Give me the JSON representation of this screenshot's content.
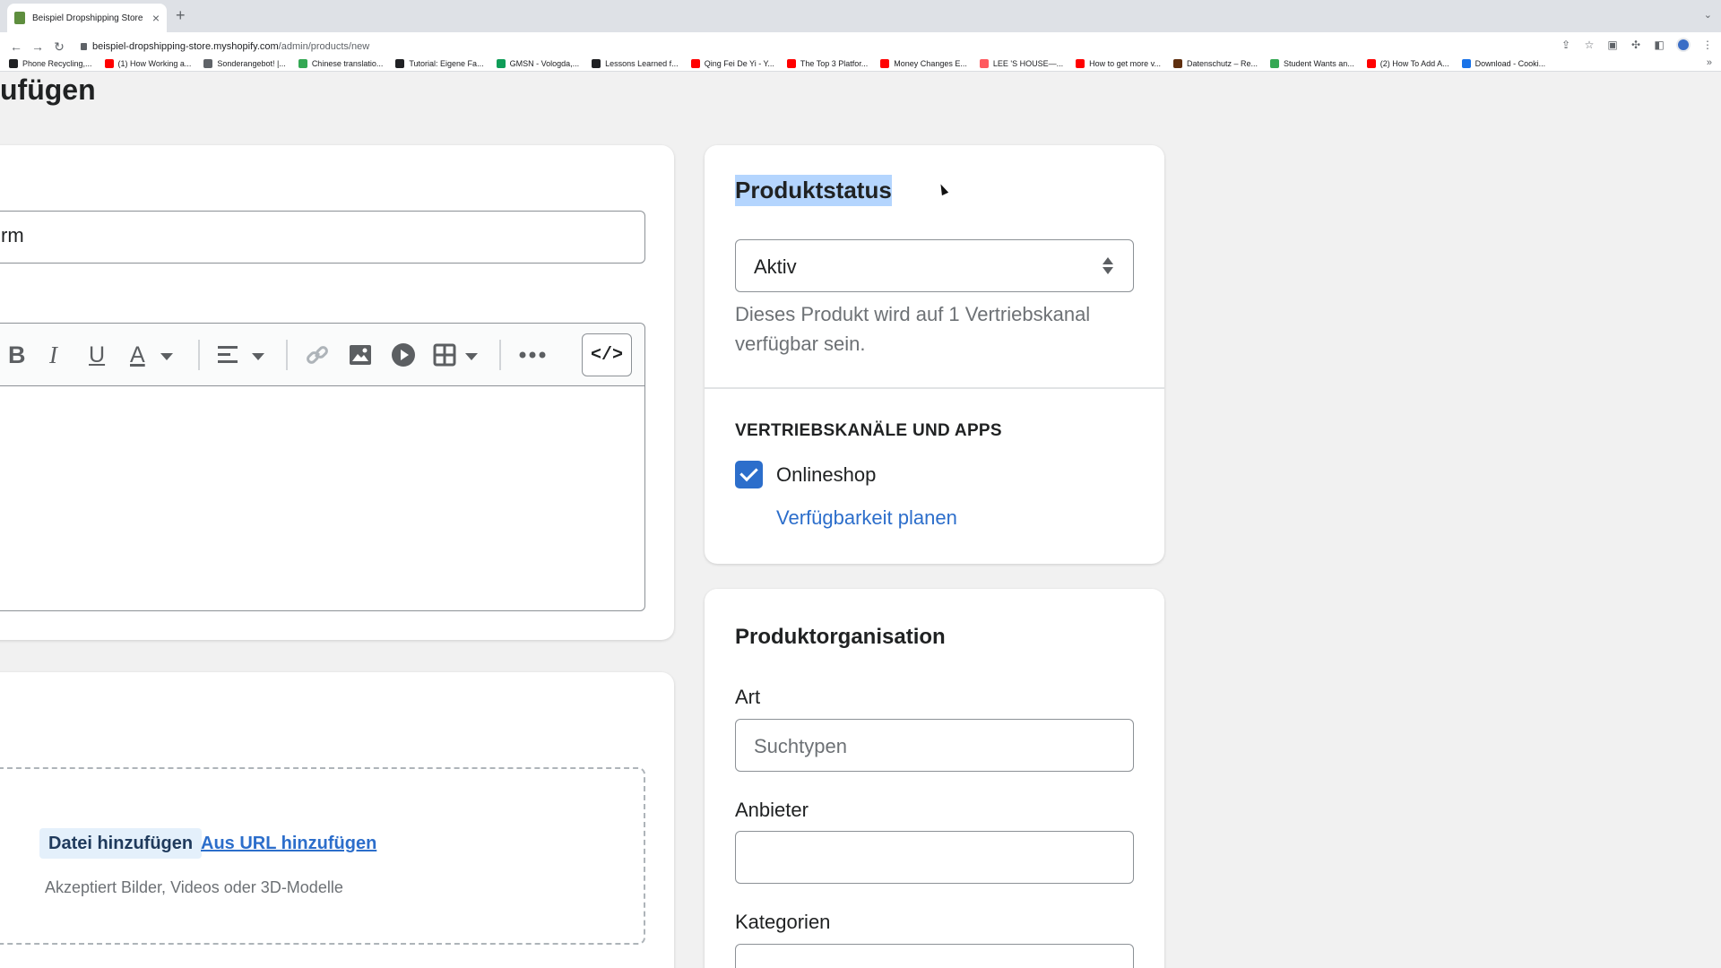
{
  "browser": {
    "tab_title": "Beispiel Dropshipping Store · Produkt hinzufügen",
    "new_tab": "+",
    "close": "×",
    "url_host": "beispiel-dropshipping-store.myshopify.com",
    "url_path": "/admin/products/new",
    "bookmarks": [
      {
        "label": "Phone Recycling,...",
        "color": "#202124"
      },
      {
        "label": "(1) How Working a...",
        "color": "#ff0000"
      },
      {
        "label": "Sonderangebot! |...",
        "color": "#5f6368"
      },
      {
        "label": "Chinese translatio...",
        "color": "#34a853"
      },
      {
        "label": "Tutorial: Eigene Fa...",
        "color": "#202124"
      },
      {
        "label": "GMSN - Vologda,...",
        "color": "#0f9d58"
      },
      {
        "label": "Lessons Learned f...",
        "color": "#202124"
      },
      {
        "label": "Qing Fei De Yi - Y...",
        "color": "#ff0000"
      },
      {
        "label": "The Top 3 Platfor...",
        "color": "#ff0000"
      },
      {
        "label": "Money Changes E...",
        "color": "#ff0000"
      },
      {
        "label": "LEE 'S HOUSE—...",
        "color": "#ff5a5f"
      },
      {
        "label": "How to get more v...",
        "color": "#ff0000"
      },
      {
        "label": "Datenschutz – Re...",
        "color": "#5f2f0f"
      },
      {
        "label": "Student Wants an...",
        "color": "#34a853"
      },
      {
        "label": "(2) How To Add A...",
        "color": "#ff0000"
      },
      {
        "label": "Download - Cooki...",
        "color": "#1a73e8"
      }
    ],
    "bookmarks_more": "»"
  },
  "page": {
    "title": "ufügen"
  },
  "product": {
    "title_value": "rm",
    "editor_toolbar": {
      "bold": "B",
      "italic": "I",
      "underline": "U",
      "text_color": "A",
      "code": "</>"
    },
    "media": {
      "add_file": "Datei hinzufügen",
      "add_url": "Aus URL hinzufügen",
      "hint": "Akzeptiert Bilder, Videos oder 3D-Modelle"
    }
  },
  "status": {
    "title": "Produktstatus",
    "selected": "Aktiv",
    "help": "Dieses Produkt wird auf 1 Vertriebskanal verfügbar sein.",
    "channels_heading": "VERTRIEBSKANÄLE UND APPS",
    "channel": "Onlineshop",
    "channel_checked": true,
    "schedule_link": "Verfügbarkeit planen"
  },
  "organization": {
    "title": "Produktorganisation",
    "type_label": "Art",
    "type_placeholder": "Suchtypen",
    "vendor_label": "Anbieter",
    "vendor_value": "",
    "categories_label": "Kategorien"
  },
  "colors": {
    "accent": "#2c6ecb",
    "highlight": "#b4d5fe",
    "background": "#f1f1f1"
  }
}
